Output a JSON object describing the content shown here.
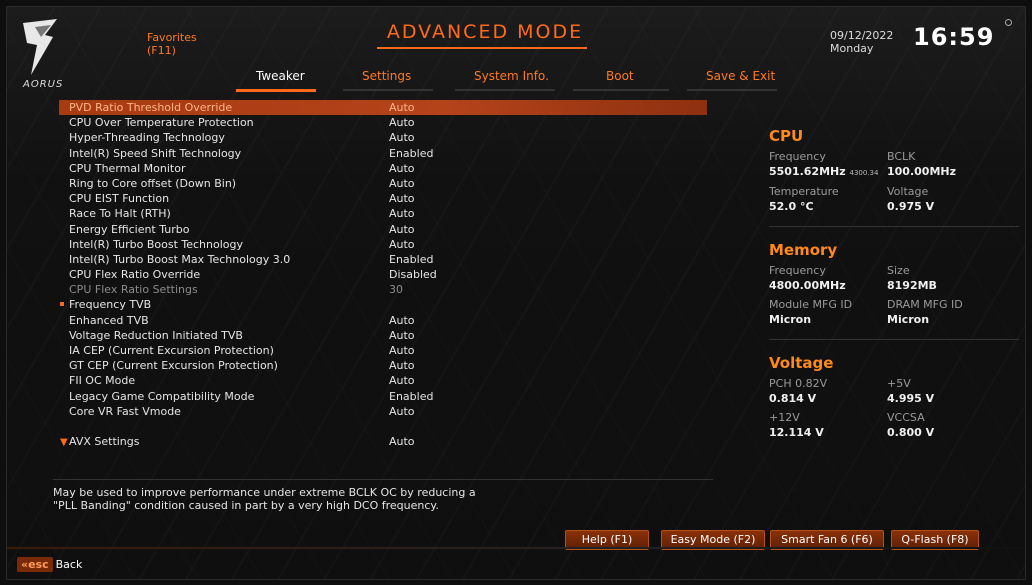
{
  "header": {
    "brand": "AORUS",
    "title": "ADVANCED MODE",
    "favorites_label": "Favorites",
    "favorites_key": "(F11)",
    "tabs": [
      "Tweaker",
      "Settings",
      "System Info.",
      "Boot",
      "Save & Exit"
    ],
    "active_tab": "Tweaker",
    "date": "09/12/2022",
    "weekday": "Monday",
    "time": "16:59"
  },
  "menu": {
    "items": [
      {
        "label": "PVD Ratio Threshold Override",
        "value": "Auto"
      },
      {
        "label": "CPU Over Temperature Protection",
        "value": "Auto"
      },
      {
        "label": "Hyper-Threading Technology",
        "value": "Auto"
      },
      {
        "label": "Intel(R) Speed Shift Technology",
        "value": "Enabled"
      },
      {
        "label": "CPU Thermal Monitor",
        "value": "Auto"
      },
      {
        "label": "Ring to Core offset (Down Bin)",
        "value": "Auto"
      },
      {
        "label": "CPU EIST Function",
        "value": "Auto"
      },
      {
        "label": "Race To Halt (RTH)",
        "value": "Auto"
      },
      {
        "label": "Energy Efficient Turbo",
        "value": "Auto"
      },
      {
        "label": "Intel(R) Turbo Boost Technology",
        "value": "Auto"
      },
      {
        "label": "Intel(R) Turbo Boost Max Technology 3.0",
        "value": "Enabled"
      },
      {
        "label": "CPU Flex Ratio Override",
        "value": "Disabled"
      },
      {
        "label": "CPU Flex Ratio Settings",
        "value": "30"
      },
      {
        "label": "Frequency TVB",
        "value": ""
      },
      {
        "label": "Enhanced TVB",
        "value": "Auto"
      },
      {
        "label": "Voltage Reduction Initiated TVB",
        "value": "Auto"
      },
      {
        "label": "IA CEP (Current Excursion Protection)",
        "value": "Auto"
      },
      {
        "label": "GT CEP (Current Excursion Protection)",
        "value": "Auto"
      },
      {
        "label": "FII OC Mode",
        "value": "Auto"
      },
      {
        "label": "Legacy Game Compatibility Mode",
        "value": "Enabled"
      },
      {
        "label": "Core VR Fast Vmode",
        "value": "Auto"
      },
      {
        "label": "AVX Settings",
        "value": "Auto"
      }
    ]
  },
  "help": {
    "line1": "May be used to improve performance under extreme BCLK OC by reducing a",
    "line2": "\"PLL Banding\" condition caused in part by a very high DCO frequency."
  },
  "side": {
    "cpu": {
      "title": "CPU",
      "freq_label": "Frequency",
      "freq_value": "5501.62MHz",
      "freq_sub": "4300.34",
      "bclk_label": "BCLK",
      "bclk_value": "100.00MHz",
      "temp_label": "Temperature",
      "temp_value": "52.0 °C",
      "volt_label": "Voltage",
      "volt_value": "0.975 V"
    },
    "memory": {
      "title": "Memory",
      "freq_label": "Frequency",
      "freq_value": "4800.00MHz",
      "size_label": "Size",
      "size_value": "8192MB",
      "mod_label": "Module MFG ID",
      "mod_value": "Micron",
      "dram_label": "DRAM MFG ID",
      "dram_value": "Micron"
    },
    "voltage": {
      "title": "Voltage",
      "pch_label": "PCH 0.82V",
      "pch_value": "0.814 V",
      "v5_label": "+5V",
      "v5_value": "4.995 V",
      "v12_label": "+12V",
      "v12_value": "12.114 V",
      "vccsa_label": "VCCSA",
      "vccsa_value": "0.800 V"
    }
  },
  "buttons": {
    "help": "Help (F1)",
    "easy": "Easy Mode (F2)",
    "fan": "Smart Fan 6 (F6)",
    "qflash": "Q-Flash (F8)"
  },
  "footer": {
    "esc_key": "esc",
    "back_label": "Back"
  }
}
